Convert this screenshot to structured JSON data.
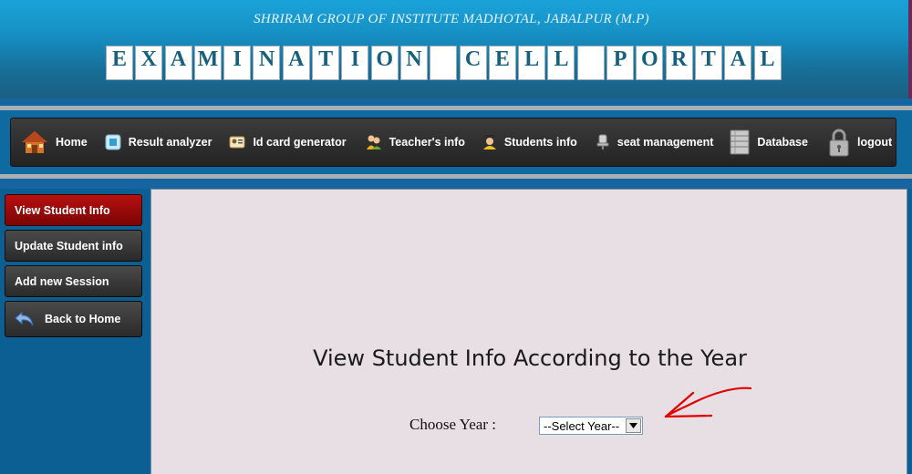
{
  "header": {
    "institute": "SHRIRAM GROUP OF INSTITUTE MADHOTAL, JABALPUR (M.P)",
    "portal_tiles": [
      "E",
      "X",
      "A",
      "M",
      "I",
      "N",
      "A",
      "T",
      "I",
      "O",
      "N",
      " ",
      "C",
      "E",
      "L",
      "L",
      " ",
      "P",
      "O",
      "R",
      "T",
      "A",
      "L"
    ]
  },
  "nav": {
    "items": [
      {
        "label": "Home",
        "icon": "house-icon"
      },
      {
        "label": "Result analyzer",
        "icon": "result-icon"
      },
      {
        "label": "Id card generator",
        "icon": "id-card-icon"
      },
      {
        "label": "Teacher's info",
        "icon": "teachers-icon"
      },
      {
        "label": "Students info",
        "icon": "student-icon"
      },
      {
        "label": "seat management",
        "icon": "seat-icon"
      },
      {
        "label": "Database",
        "icon": "database-icon"
      },
      {
        "label": "logout",
        "icon": "lock-icon"
      }
    ]
  },
  "sidebar": {
    "items": [
      {
        "label": "View Student Info",
        "active": true
      },
      {
        "label": "Update Student info",
        "active": false
      },
      {
        "label": "Add new Session",
        "active": false
      },
      {
        "label": "Back to Home",
        "active": false,
        "icon": "back-arrow-icon"
      }
    ]
  },
  "main": {
    "heading": "View Student Info According to the Year",
    "year_label": "Choose Year :",
    "year_select": {
      "selected": "--Select Year--"
    }
  },
  "colors": {
    "header_top": "#1aa3d9",
    "body_blue": "#0a6196",
    "nav_bg": "#2e2e2e",
    "sidebar_active": "#a50c0c",
    "main_bg": "#e7dfe3",
    "annotation_arrow": "#e00000"
  }
}
